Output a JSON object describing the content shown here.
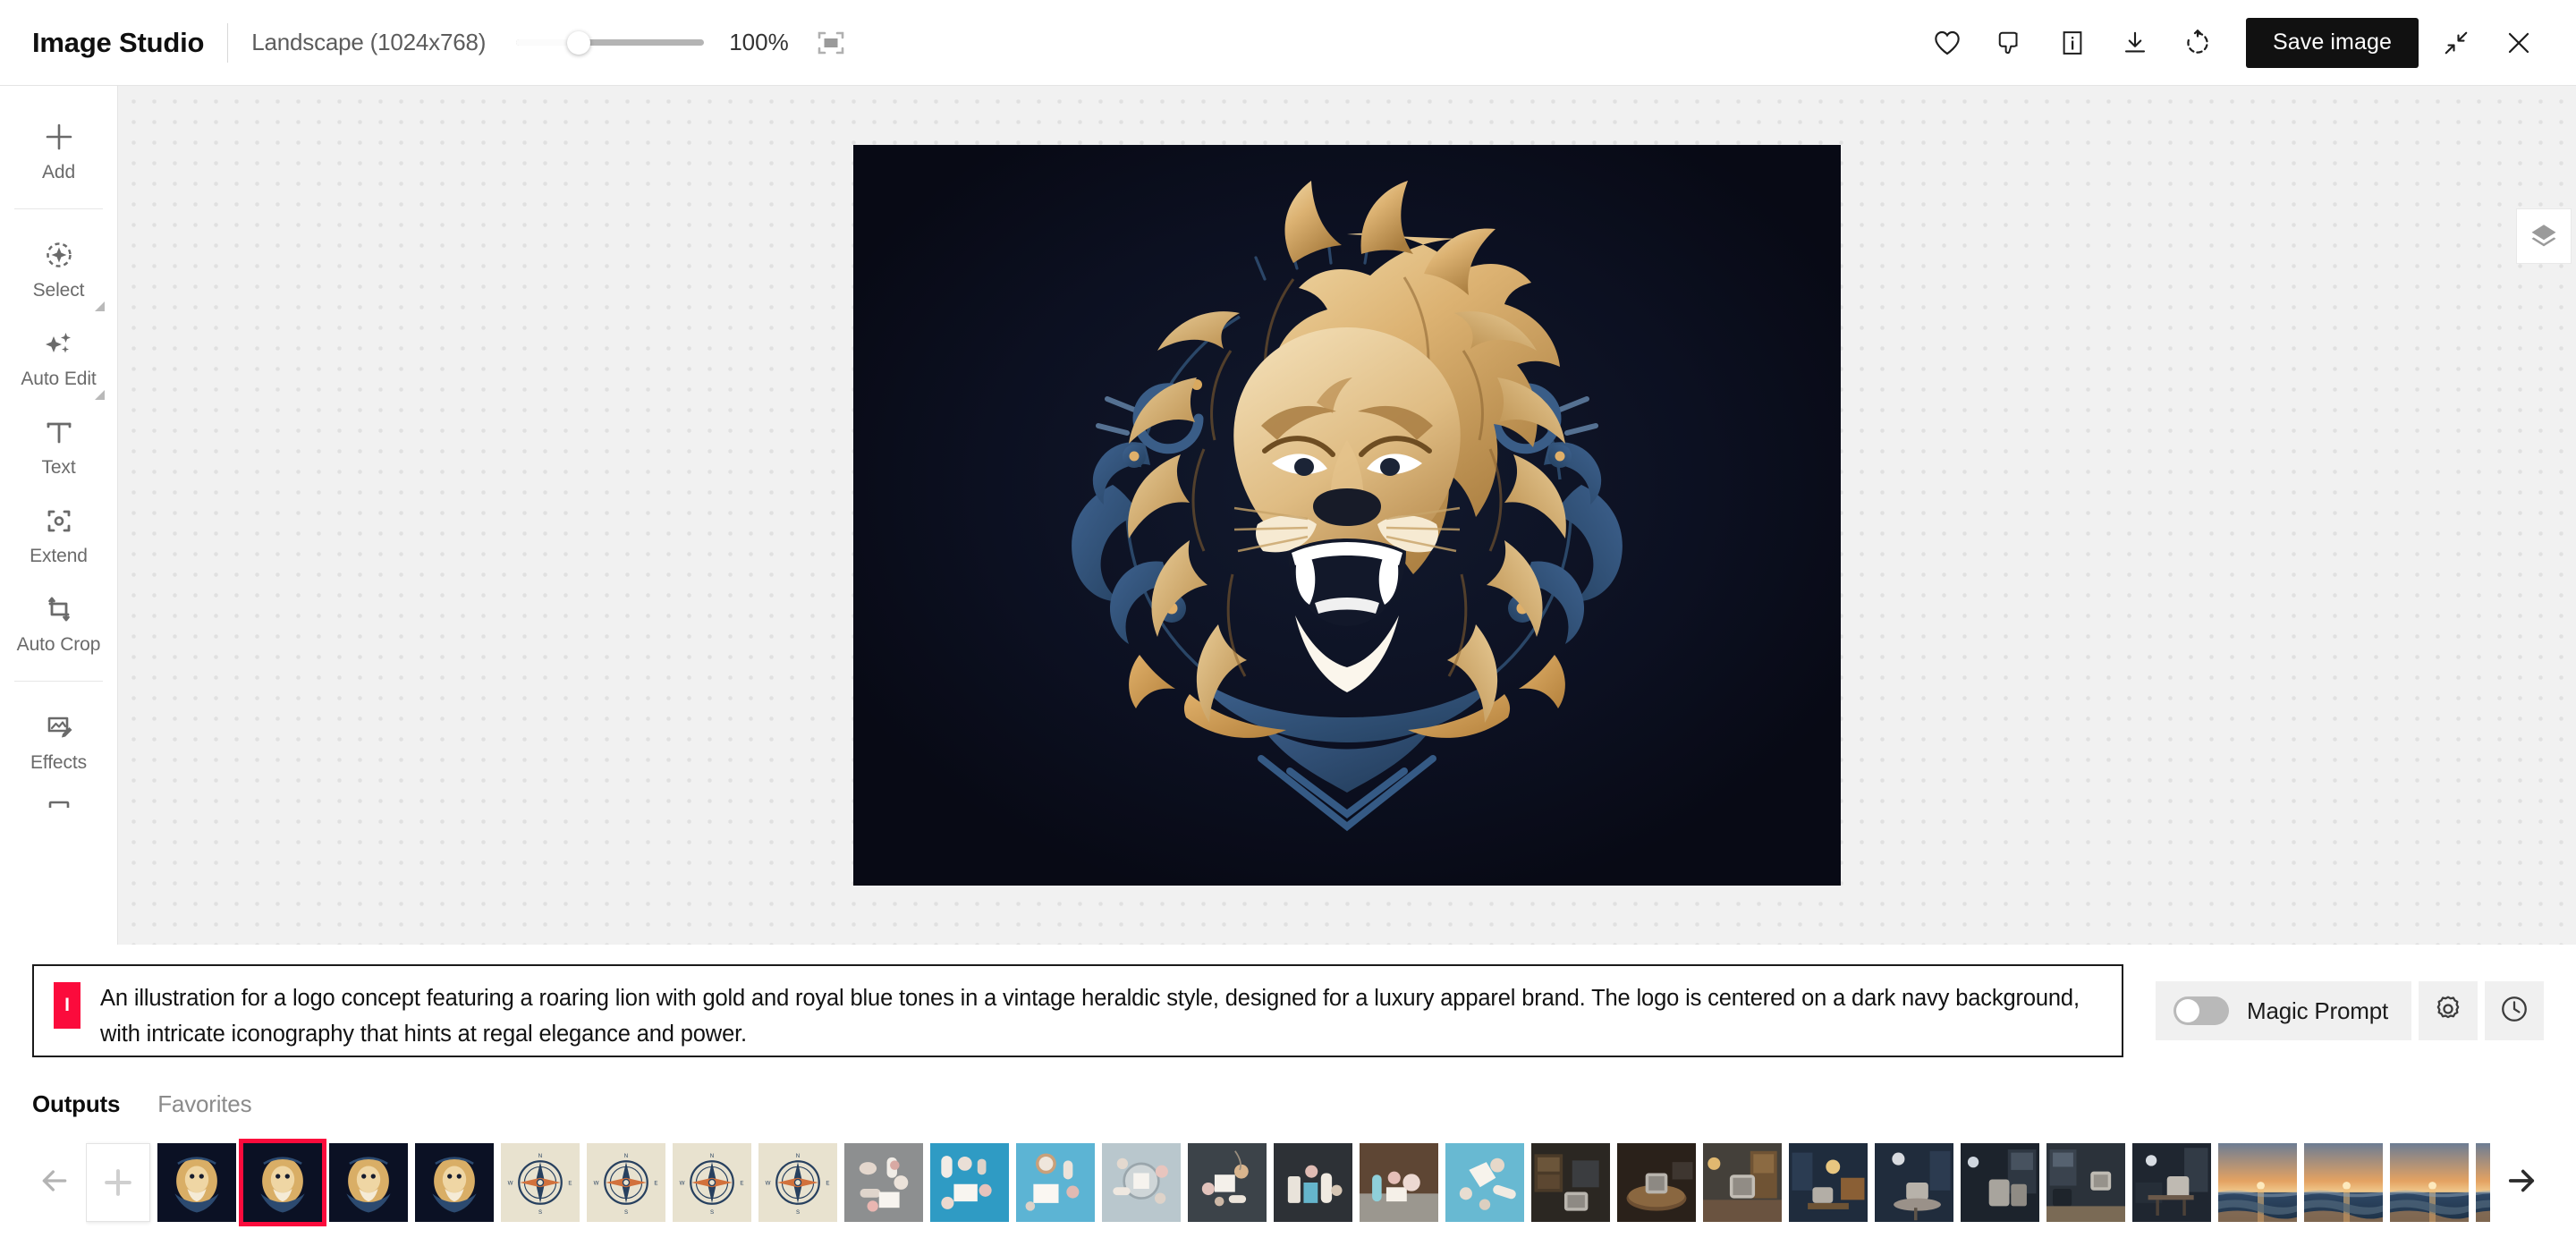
{
  "header": {
    "app_title": "Image Studio",
    "aspect_ratio": "Landscape (1024x768)",
    "zoom_percent": "100%",
    "zoom_value": 33,
    "fit_icon": "fit-to-screen-icon",
    "actions": [
      {
        "name": "favorite-icon",
        "label": "Favorite"
      },
      {
        "name": "thumbs-down-icon",
        "label": "Dislike"
      },
      {
        "name": "info-icon",
        "label": "Info"
      },
      {
        "name": "download-icon",
        "label": "Download"
      },
      {
        "name": "regenerate-icon",
        "label": "Regenerate"
      }
    ],
    "save_label": "Save image",
    "collapse_icon": "collapse-icon",
    "close_icon": "close-icon"
  },
  "sidebar": {
    "items": [
      {
        "label": "Add",
        "icon": "plus-icon",
        "has_submenu": false
      },
      {
        "label": "Select",
        "icon": "select-icon",
        "has_submenu": true
      },
      {
        "label": "Auto Edit",
        "icon": "sparkles-icon",
        "has_submenu": true
      },
      {
        "label": "Text",
        "icon": "text-icon",
        "has_submenu": false
      },
      {
        "label": "Extend",
        "icon": "extend-icon",
        "has_submenu": false
      },
      {
        "label": "Auto Crop",
        "icon": "crop-icon",
        "has_submenu": false
      },
      {
        "label": "Effects",
        "icon": "effects-icon",
        "has_submenu": false
      }
    ]
  },
  "canvas": {
    "layers_icon": "layers-icon",
    "image_description": "Heraldic roaring lion logo in gold and royal blue on dark navy background",
    "background_color": "#0a0a16"
  },
  "prompt": {
    "badge": "I",
    "badge_color": "#fb0b3c",
    "text": "An illustration for a logo concept featuring a roaring lion with gold and royal blue tones in a vintage heraldic style, designed for a luxury apparel brand. The logo is centered on a dark navy background, with intricate iconography that hints at regal elegance and power.",
    "magic_prompt_label": "Magic Prompt",
    "magic_prompt_on": false,
    "settings_icon": "gear-icon",
    "history_icon": "clock-icon"
  },
  "tabs": [
    {
      "label": "Outputs",
      "active": true
    },
    {
      "label": "Favorites",
      "active": false
    }
  ],
  "filmstrip": {
    "prev_icon": "arrow-left-icon",
    "next_icon": "arrow-right-icon",
    "add_icon": "plus-icon",
    "thumbnails": [
      {
        "kind": "lion",
        "selected": false
      },
      {
        "kind": "lion",
        "selected": true
      },
      {
        "kind": "lion",
        "selected": false
      },
      {
        "kind": "lion",
        "selected": false
      },
      {
        "kind": "compass",
        "selected": false
      },
      {
        "kind": "compass",
        "selected": false
      },
      {
        "kind": "compass",
        "selected": false
      },
      {
        "kind": "compass",
        "selected": false
      },
      {
        "kind": "spa-gray",
        "selected": false
      },
      {
        "kind": "spa-blue",
        "selected": false
      },
      {
        "kind": "spa-blue2",
        "selected": false
      },
      {
        "kind": "spa-light",
        "selected": false
      },
      {
        "kind": "spa-dark",
        "selected": false
      },
      {
        "kind": "spa-dark2",
        "selected": false
      },
      {
        "kind": "spa-brown",
        "selected": false
      },
      {
        "kind": "spa-teal",
        "selected": false
      },
      {
        "kind": "speaker-shelf",
        "selected": false
      },
      {
        "kind": "speaker-table",
        "selected": false
      },
      {
        "kind": "speaker-wood",
        "selected": false
      },
      {
        "kind": "speaker-navy",
        "selected": false
      },
      {
        "kind": "speaker-navy2",
        "selected": false
      },
      {
        "kind": "speaker-dark",
        "selected": false
      },
      {
        "kind": "speaker-room",
        "selected": false
      },
      {
        "kind": "speaker-desk",
        "selected": false
      },
      {
        "kind": "sunset",
        "selected": false
      },
      {
        "kind": "sunset",
        "selected": false
      },
      {
        "kind": "sunset",
        "selected": false
      },
      {
        "kind": "sunset",
        "selected": false
      },
      {
        "kind": "clipped",
        "selected": false
      }
    ]
  }
}
